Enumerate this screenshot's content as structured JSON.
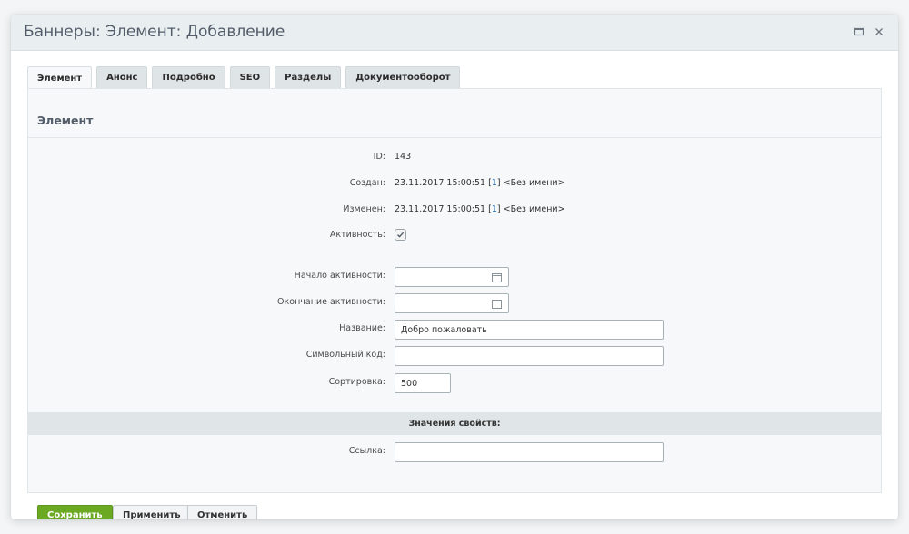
{
  "dialog": {
    "title": "Баннеры: Элемент: Добавление"
  },
  "tabs": [
    {
      "label": "Элемент",
      "active": true
    },
    {
      "label": "Анонс"
    },
    {
      "label": "Подробно"
    },
    {
      "label": "SEO"
    },
    {
      "label": "Разделы"
    },
    {
      "label": "Документооборот"
    }
  ],
  "section": {
    "title": "Элемент"
  },
  "fields": {
    "id": {
      "label": "ID:",
      "value": "143"
    },
    "created": {
      "label": "Создан:",
      "date": "23.11.2017 15:00:51",
      "user_id_link": "1",
      "user_name": "<Без имени>"
    },
    "modified": {
      "label": "Изменен:",
      "date": "23.11.2017 15:00:51",
      "user_id_link": "1",
      "user_name": "<Без имени>"
    },
    "active": {
      "label": "Активность:",
      "checked": true
    },
    "active_from": {
      "label": "Начало активности:",
      "value": ""
    },
    "active_to": {
      "label": "Окончание активности:",
      "value": ""
    },
    "name": {
      "label": "Название:",
      "value": "Добро пожаловать"
    },
    "code": {
      "label": "Символьный код:",
      "value": ""
    },
    "sort": {
      "label": "Сортировка:",
      "value": "500"
    }
  },
  "properties": {
    "title": "Значения свойств:",
    "link": {
      "label": "Ссылка:",
      "value": ""
    }
  },
  "buttons": {
    "save": "Сохранить",
    "apply": "Применить",
    "cancel": "Отменить"
  },
  "colors": {
    "save_button": "#6ba923",
    "link": "#2067b0"
  },
  "icons": {
    "maximize": "maximize-icon",
    "close": "close-icon",
    "calendar": "calendar-icon",
    "check": "check-icon"
  }
}
